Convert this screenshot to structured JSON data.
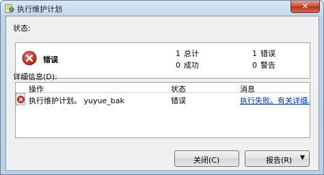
{
  "window": {
    "title": "执行维护计划",
    "close_glyph": "✕"
  },
  "status_label": "状态:",
  "summary": {
    "state": "错误",
    "stats": {
      "total": {
        "count": "1",
        "label": "总计"
      },
      "success": {
        "count": "0",
        "label": "成功"
      },
      "error": {
        "count": "1",
        "label": "错误"
      },
      "warning": {
        "count": "0",
        "label": "警告"
      }
    }
  },
  "details_label": "详细信息(D):",
  "table": {
    "columns": [
      "操作",
      "状态",
      "消息"
    ],
    "rows": [
      {
        "action": "执行维护计划。 yuyue_bak",
        "status": "错误",
        "message": "执行失败。有关详细..."
      }
    ]
  },
  "buttons": {
    "close": "关闭(C)",
    "report": "报告(R)",
    "report_arrow": "▼"
  },
  "colors": {
    "error_red": "#d9322a",
    "link_blue": "#0033cc"
  },
  "icons": {
    "app": "maintenance-plan-icon",
    "error": "error-circle-x-icon"
  }
}
